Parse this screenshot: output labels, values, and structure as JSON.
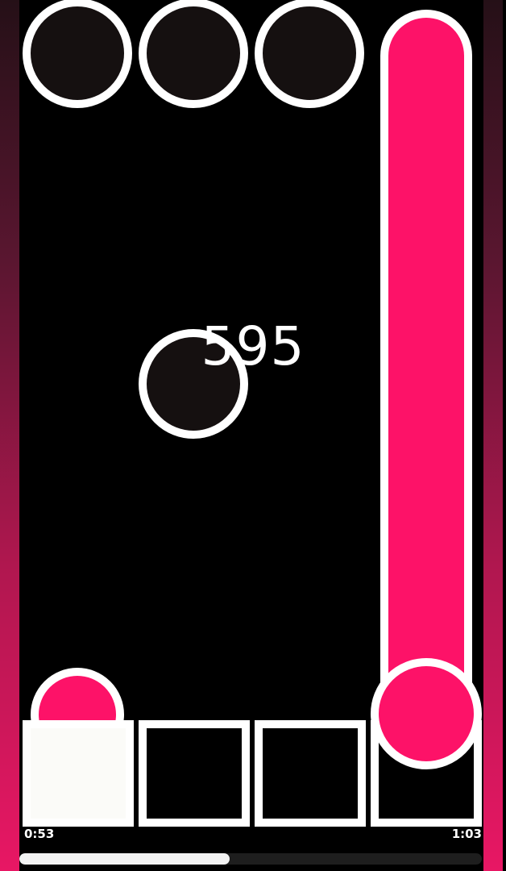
{
  "game": {
    "score": "595",
    "accent_color": "#fd1268",
    "ring_color": "#ffffff"
  },
  "pads": [
    {
      "state": "pressed"
    },
    {
      "state": "idle"
    },
    {
      "state": "idle"
    },
    {
      "state": "active-hold"
    }
  ],
  "song": {
    "elapsed": "0:53",
    "total": "1:03",
    "progress_fraction": 0.454
  }
}
